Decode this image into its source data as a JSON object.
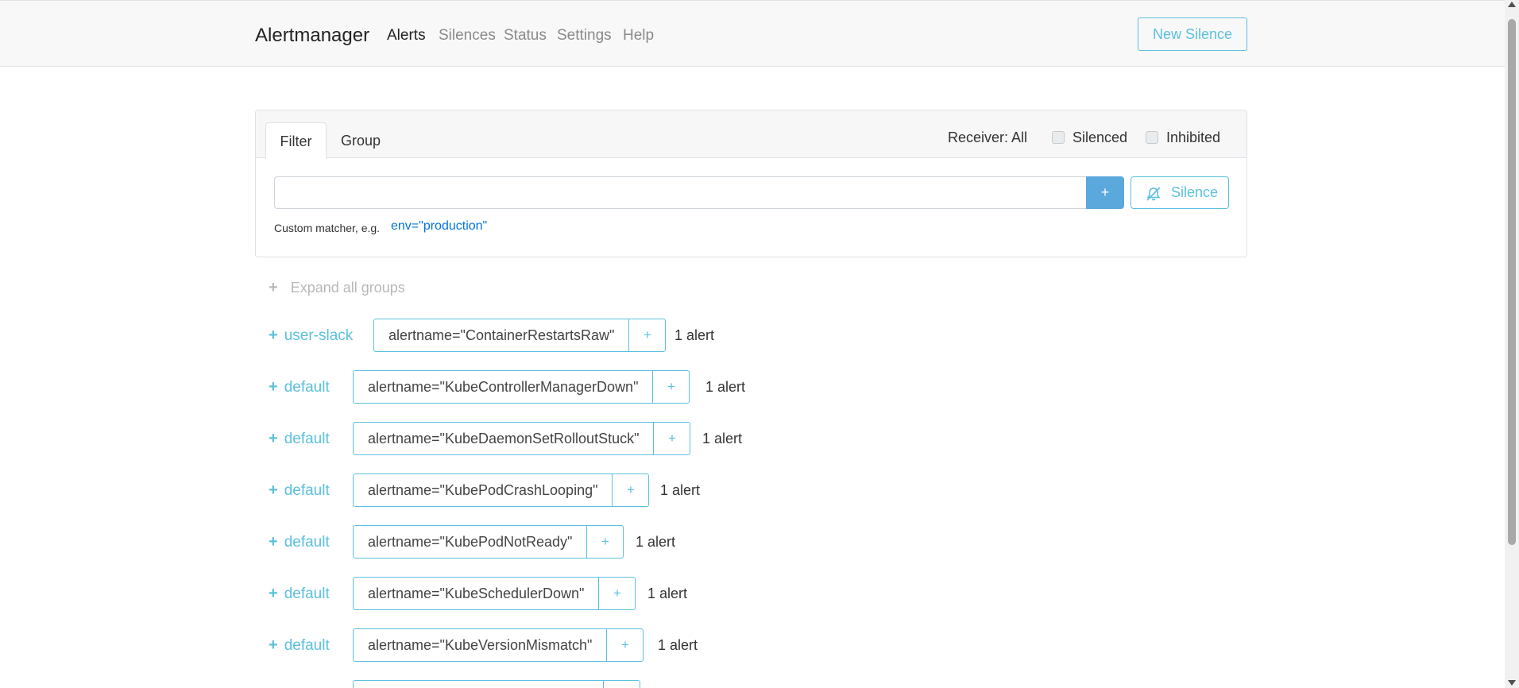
{
  "app": {
    "title": "Alertmanager"
  },
  "nav": {
    "items": [
      {
        "label": "Alerts",
        "active": true
      },
      {
        "label": "Silences",
        "active": false
      },
      {
        "label": "Status",
        "active": false
      },
      {
        "label": "Settings",
        "active": false
      },
      {
        "label": "Help",
        "active": false
      }
    ],
    "new_silence_label": "New Silence"
  },
  "filter": {
    "tabs": [
      {
        "label": "Filter",
        "active": true
      },
      {
        "label": "Group",
        "active": false
      }
    ],
    "receiver_label": "Receiver: All",
    "silenced_label": "Silenced",
    "inhibited_label": "Inhibited",
    "input_value": "",
    "add_label": "+",
    "silence_label": "Silence",
    "hint_label": "Custom matcher, e.g.",
    "hint_example": "env=\"production\""
  },
  "expand_all_label": "Expand all groups",
  "toggle_plus": "+",
  "groups": [
    {
      "receiver": "user-slack",
      "matcher": "alertname=\"ContainerRestartsRaw\"",
      "plus": "+",
      "count": "1 alert"
    },
    {
      "receiver": "default",
      "matcher": "alertname=\"KubeControllerManagerDown\"",
      "plus": "+",
      "count": "1 alert"
    },
    {
      "receiver": "default",
      "matcher": "alertname=\"KubeDaemonSetRolloutStuck\"",
      "plus": "+",
      "count": "1 alert"
    },
    {
      "receiver": "default",
      "matcher": "alertname=\"KubePodCrashLooping\"",
      "plus": "+",
      "count": "1 alert"
    },
    {
      "receiver": "default",
      "matcher": "alertname=\"KubePodNotReady\"",
      "plus": "+",
      "count": "1 alert"
    },
    {
      "receiver": "default",
      "matcher": "alertname=\"KubeSchedulerDown\"",
      "plus": "+",
      "count": "1 alert"
    },
    {
      "receiver": "default",
      "matcher": "alertname=\"KubeVersionMismatch\"",
      "plus": "+",
      "count": "1 alert"
    }
  ],
  "colors": {
    "accent": "#5bc0de",
    "primary": "#5ba8dc",
    "link": "#0275d8"
  }
}
